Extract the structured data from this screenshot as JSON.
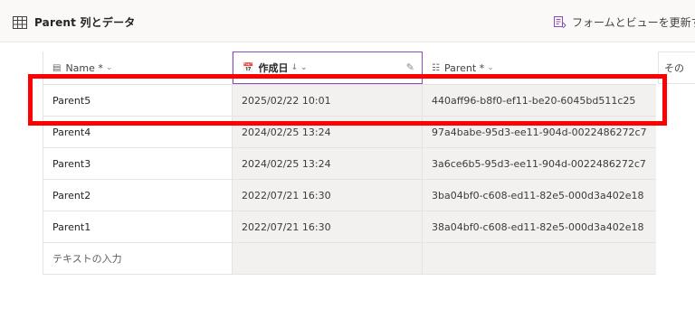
{
  "header": {
    "title": "Parent 列とデータ",
    "update_label": "フォームとビューを更新す"
  },
  "columns": [
    {
      "label": "Name *",
      "icon": "text-field-icon"
    },
    {
      "label": "作成日",
      "icon": "calendar-icon",
      "sort": "↓"
    },
    {
      "label": "Parent *",
      "icon": "lookup-icon"
    },
    {
      "label": "その"
    }
  ],
  "rows": [
    {
      "name": "Parent5",
      "created": "2025/02/22 10:01",
      "parent": "440aff96-b8f0-ef11-be20-6045bd511c25"
    },
    {
      "name": "Parent4",
      "created": "2024/02/25 13:24",
      "parent": "97a4babe-95d3-ee11-904d-0022486272c7"
    },
    {
      "name": "Parent3",
      "created": "2024/02/25 13:24",
      "parent": "3a6ce6b5-95d3-ee11-904d-0022486272c7"
    },
    {
      "name": "Parent2",
      "created": "2022/07/21 16:30",
      "parent": "3ba04bf0-c608-ed11-82e5-000d3a402e18"
    },
    {
      "name": "Parent1",
      "created": "2022/07/21 16:30",
      "parent": "38a04bf0-c608-ed11-82e5-000d3a402e18"
    }
  ],
  "new_row_placeholder": "テキストの入力",
  "colors": {
    "accent_purple": "#8a4db7",
    "highlight_red": "#ff0000"
  }
}
